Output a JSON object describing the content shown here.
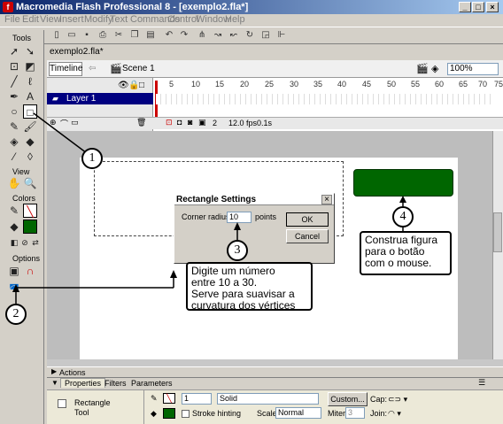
{
  "window": {
    "title": "Macromedia Flash Professional 8 - [exemplo2.fla*]"
  },
  "menu": [
    "File",
    "Edit",
    "View",
    "Insert",
    "Modify",
    "Text",
    "Commands",
    "Control",
    "Window",
    "Help"
  ],
  "tools": {
    "sections": {
      "tools": "Tools",
      "view": "View",
      "colors": "Colors",
      "options": "Options"
    }
  },
  "document": {
    "tab": "exemplo2.fla*",
    "timeline_button": "Timeline",
    "scene": "Scene 1",
    "zoom": "100%"
  },
  "timeline": {
    "layer_name": "Layer 1",
    "frame_numbers": [
      "5",
      "10",
      "15",
      "20",
      "25",
      "30",
      "35",
      "40",
      "45",
      "50",
      "55",
      "60",
      "65",
      "70",
      "75"
    ],
    "current_frame": "2",
    "fps": "12.0 fps",
    "elapsed": "0.1s"
  },
  "dialog": {
    "title": "Rectangle Settings",
    "label": "Corner radius:",
    "value": "10",
    "unit": "points",
    "ok": "OK",
    "cancel": "Cancel"
  },
  "callouts": {
    "c1": "1",
    "c2": "2",
    "c3": "3",
    "c4": "4",
    "note_radius": [
      "Digite um número",
      "entre 10 a 30.",
      "Serve para suavisar a",
      "curvatura dos vértices"
    ],
    "note_draw": [
      "Construa figura",
      "para o botão",
      "com o mouse."
    ]
  },
  "panels": {
    "actions": "Actions",
    "properties": "Properties",
    "filters": "Filters",
    "parameters": "Parameters"
  },
  "properties": {
    "tool_name": [
      "Rectangle",
      "Tool"
    ],
    "stroke_width": "1",
    "stroke_style": "Solid",
    "custom": "Custom...",
    "cap_label": "Cap:",
    "stroke_hinting": "Stroke hinting",
    "scale_label": "Scale:",
    "scale_value": "Normal",
    "miter_label": "Miter:",
    "miter_value": "3",
    "join_label": "Join:"
  },
  "colors": {
    "fill": "#006600",
    "title_bar": "#0a246a"
  }
}
